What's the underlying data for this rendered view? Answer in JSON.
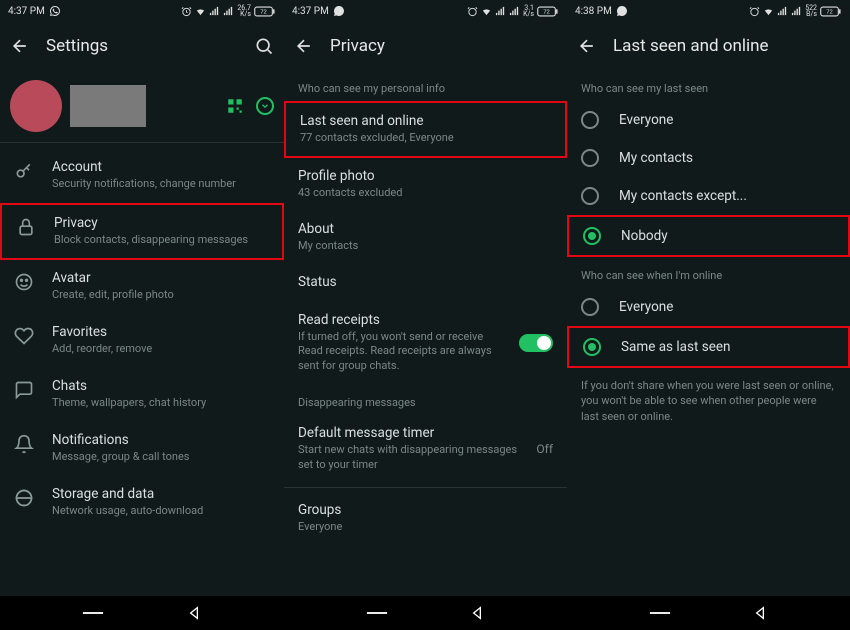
{
  "statusbar": {
    "time1": "4:37 PM",
    "time2": "4:37 PM",
    "time3": "4:38 PM",
    "speed1_top": "26.7",
    "speed1_bot": "K/s",
    "speed2_top": "3.1",
    "speed2_bot": "K/s",
    "speed3_top": "522",
    "speed3_bot": "B/s",
    "battery": "72"
  },
  "screen1": {
    "title": "Settings",
    "items": [
      {
        "title": "Account",
        "sub": "Security notifications, change number"
      },
      {
        "title": "Privacy",
        "sub": "Block contacts, disappearing messages"
      },
      {
        "title": "Avatar",
        "sub": "Create, edit, profile photo"
      },
      {
        "title": "Favorites",
        "sub": "Add, reorder, remove"
      },
      {
        "title": "Chats",
        "sub": "Theme, wallpapers, chat history"
      },
      {
        "title": "Notifications",
        "sub": "Message, group & call tones"
      },
      {
        "title": "Storage and data",
        "sub": "Network usage, auto-download"
      }
    ]
  },
  "screen2": {
    "title": "Privacy",
    "section1": "Who can see my personal info",
    "lastseen": {
      "title": "Last seen and online",
      "sub": "77 contacts excluded, Everyone"
    },
    "photo": {
      "title": "Profile photo",
      "sub": "43 contacts excluded"
    },
    "about": {
      "title": "About",
      "sub": "My contacts"
    },
    "status": {
      "title": "Status"
    },
    "receipts": {
      "title": "Read receipts",
      "sub": "If turned off, you won't send or receive Read receipts. Read receipts are always sent for group chats."
    },
    "section2": "Disappearing messages",
    "timer": {
      "title": "Default message timer",
      "sub": "Start new chats with disappearing messages set to your timer",
      "value": "Off"
    },
    "groups": {
      "title": "Groups",
      "sub": "Everyone"
    }
  },
  "screen3": {
    "title": "Last seen and online",
    "section1": "Who can see my last seen",
    "options1": [
      "Everyone",
      "My contacts",
      "My contacts except...",
      "Nobody"
    ],
    "section2": "Who can see when I'm online",
    "options2": [
      "Everyone",
      "Same as last seen"
    ],
    "note": "If you don't share when you were last seen or online, you won't be able to see when other people were last seen or online."
  }
}
